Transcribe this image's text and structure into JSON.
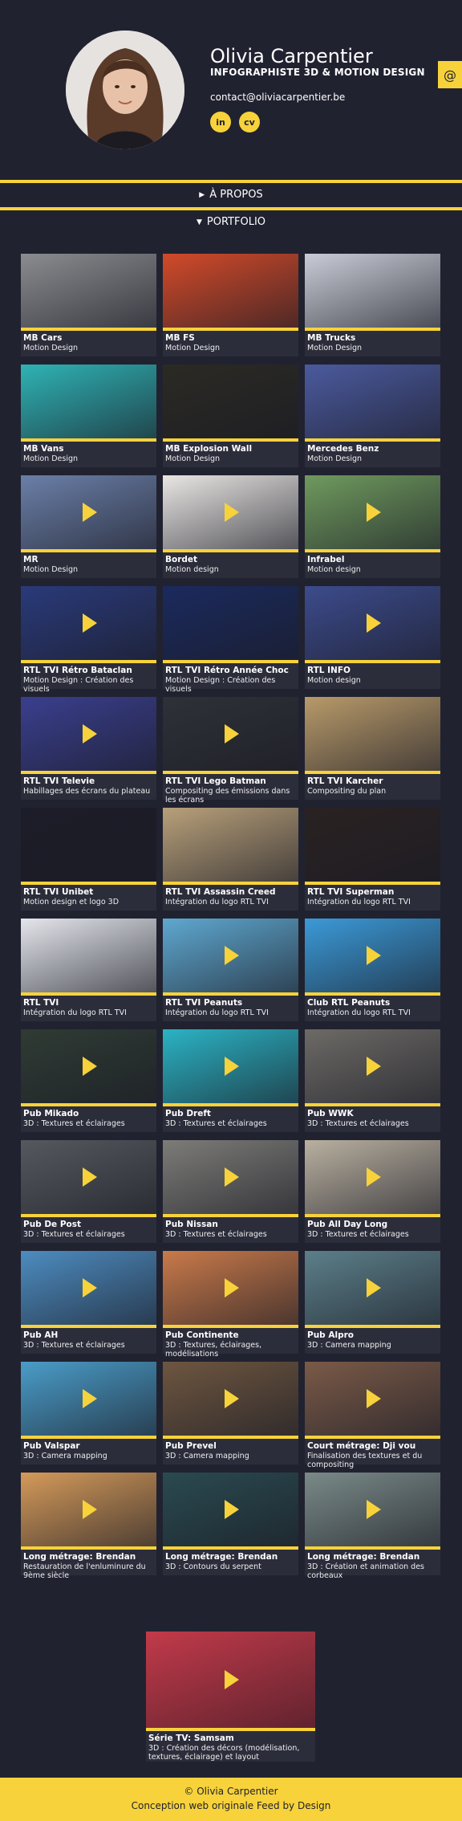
{
  "profile": {
    "name": "Olivia Carpentier",
    "role": "INFOGRAPHISTE 3D & MOTION DESIGN",
    "email": "contact@oliviacarpentier.be",
    "social": [
      {
        "label": "in",
        "icon": "linkedin-icon"
      },
      {
        "label": "cv",
        "icon": "cv-icon"
      }
    ],
    "contact_button": "@"
  },
  "sections": {
    "about": "À PROPOS",
    "portfolio": "PORTFOLIO"
  },
  "colors": {
    "accent": "#f7d23a",
    "background": "#212230",
    "card": "#2c2d3b"
  },
  "portfolio": [
    {
      "title": "MB Cars",
      "sub": "Motion Design",
      "bg": "#8a8c8f",
      "play": false
    },
    {
      "title": "MB FS",
      "sub": "Motion Design",
      "bg": "#d24a2a",
      "play": false
    },
    {
      "title": "MB Trucks",
      "sub": "Motion Design",
      "bg": "#c9ccd6",
      "play": false
    },
    {
      "title": "MB Vans",
      "sub": "Motion Design",
      "bg": "#2fb3b5",
      "play": false
    },
    {
      "title": "MB Explosion Wall",
      "sub": "Motion Design",
      "bg": "#2b2a24",
      "play": false
    },
    {
      "title": "Mercedes Benz",
      "sub": "Motion Design",
      "bg": "#4b5a9e",
      "play": false
    },
    {
      "title": "MR",
      "sub": "Motion Design",
      "bg": "#6b7fa8",
      "play": true
    },
    {
      "title": "Bordet",
      "sub": "Motion design",
      "bg": "#e9e6e3",
      "play": true
    },
    {
      "title": "Infrabel",
      "sub": "Motion design",
      "bg": "#6f9a5e",
      "play": true
    },
    {
      "title": "RTL TVI Rétro Bataclan",
      "sub": "Motion Design : Création des visuels",
      "bg": "#2a3a7a",
      "play": true
    },
    {
      "title": "RTL TVI Rétro Année Choc",
      "sub": "Motion Design : Création des visuels",
      "bg": "#1b2a5e",
      "play": false
    },
    {
      "title": "RTL INFO",
      "sub": "Motion design",
      "bg": "#3c4b8c",
      "play": true
    },
    {
      "title": "RTL TVI Televie",
      "sub": "Habillages des écrans du plateau",
      "bg": "#3a3f8e",
      "play": true
    },
    {
      "title": "RTL TVI Lego Batman",
      "sub": "Compositing des émissions dans les écrans",
      "bg": "#2f3138",
      "play": true
    },
    {
      "title": "RTL TVI Karcher",
      "sub": "Compositing du plan",
      "bg": "#b89a6a",
      "play": false
    },
    {
      "title": "RTL TVI Unibet",
      "sub": "Motion design et logo 3D",
      "bg": "#1c1d28",
      "play": false
    },
    {
      "title": "RTL TVI Assassin Creed",
      "sub": "Intégration du logo RTL TVI",
      "bg": "#b8a07a",
      "play": false
    },
    {
      "title": "RTL TVI Superman",
      "sub": "Intégration du logo RTL TVI",
      "bg": "#2a2222",
      "play": false
    },
    {
      "title": "RTL TVI",
      "sub": "Intégration du logo RTL TVI",
      "bg": "#e4e6ec",
      "play": false
    },
    {
      "title": "RTL TVI Peanuts",
      "sub": "Intégration du logo RTL TVI",
      "bg": "#5fa8d0",
      "play": true
    },
    {
      "title": "Club RTL Peanuts",
      "sub": "Intégration du logo RTL TVI",
      "bg": "#3b9ad8",
      "play": true
    },
    {
      "title": "Pub Mikado",
      "sub": "3D : Textures et éclairages",
      "bg": "#2f3b34",
      "play": true
    },
    {
      "title": "Pub Dreft",
      "sub": "3D : Textures et éclairages",
      "bg": "#2bb3c4",
      "play": true
    },
    {
      "title": "Pub WWK",
      "sub": "3D : Textures et éclairages",
      "bg": "#6d6a66",
      "play": true
    },
    {
      "title": "Pub De Post",
      "sub": "3D : Textures et éclairages",
      "bg": "#55595e",
      "play": true
    },
    {
      "title": "Pub Nissan",
      "sub": "3D : Textures et éclairages",
      "bg": "#7d7c78",
      "play": true
    },
    {
      "title": "Pub All Day Long",
      "sub": "3D : Textures et éclairages",
      "bg": "#b9b0a0",
      "play": true
    },
    {
      "title": "Pub AH",
      "sub": "3D : Textures et éclairages",
      "bg": "#4d8cc0",
      "play": true
    },
    {
      "title": "Pub Continente",
      "sub": "3D : Textures, éclairages, modélisations",
      "bg": "#c97a4a",
      "play": true
    },
    {
      "title": "Pub Alpro",
      "sub": "3D : Camera mapping",
      "bg": "#5c7f8a",
      "play": true
    },
    {
      "title": "Pub Valspar",
      "sub": "3D : Camera mapping",
      "bg": "#4a9cc8",
      "play": true
    },
    {
      "title": "Pub Prevel",
      "sub": "3D : Camera mapping",
      "bg": "#6e5640",
      "play": true
    },
    {
      "title": "Court métrage: Dji vou",
      "sub": "Finalisation des textures et du compositing",
      "bg": "#7a5a48",
      "play": true
    },
    {
      "title": "Long métrage: Brendan",
      "sub": "Restauration de l'enluminure du 9ème siècle",
      "bg": "#d49a5a",
      "play": true
    },
    {
      "title": "Long métrage: Brendan",
      "sub": "3D : Contours du serpent",
      "bg": "#2a4a50",
      "play": true
    },
    {
      "title": "Long métrage: Brendan",
      "sub": "3D : Création et animation des corbeaux",
      "bg": "#7a8a88",
      "play": true
    }
  ],
  "last": {
    "title": "Série TV: Samsam",
    "sub": "3D : Création des décors (modélisation, textures, éclairage) et layout",
    "bg": "#c23a4a",
    "play": true
  },
  "footer": {
    "copyright": "© Olivia Carpentier",
    "credit": "Conception web originale Feed by Design"
  }
}
